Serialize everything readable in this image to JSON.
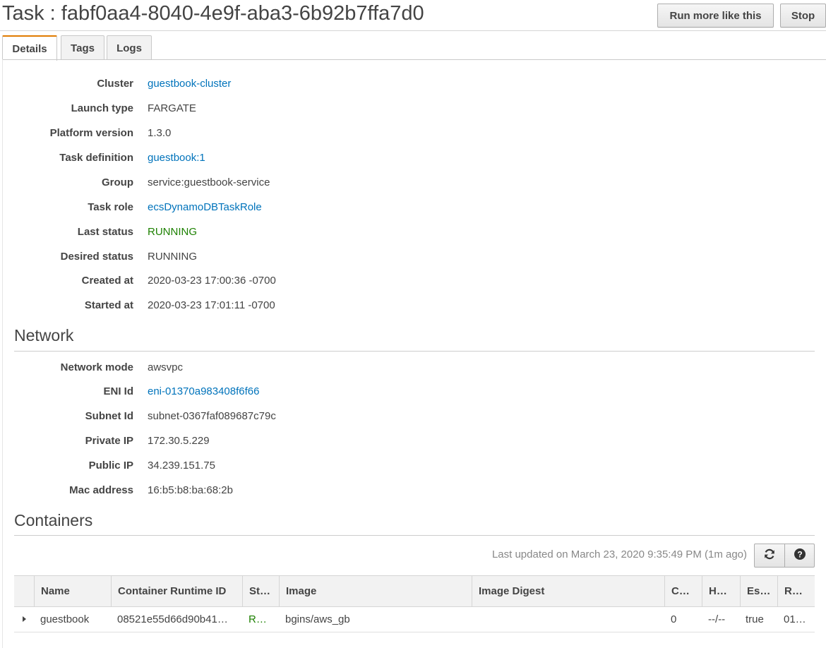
{
  "header": {
    "title": "Task : fabf0aa4-8040-4e9f-aba3-6b92b7ffa7d0",
    "run_more_label": "Run more like this",
    "stop_label": "Stop"
  },
  "tabs": [
    {
      "label": "Details",
      "active": true
    },
    {
      "label": "Tags",
      "active": false
    },
    {
      "label": "Logs",
      "active": false
    }
  ],
  "details": [
    {
      "label": "Cluster",
      "value": "guestbook-cluster"
    },
    {
      "label": "Launch type",
      "value": "FARGATE"
    },
    {
      "label": "Platform version",
      "value": "1.3.0"
    },
    {
      "label": "Task definition",
      "value": "guestbook:1"
    },
    {
      "label": "Group",
      "value": "service:guestbook-service"
    },
    {
      "label": "Task role",
      "value": "ecsDynamoDBTaskRole"
    },
    {
      "label": "Last status",
      "value": "RUNNING"
    },
    {
      "label": "Desired status",
      "value": "RUNNING"
    },
    {
      "label": "Created at",
      "value": "2020-03-23 17:00:36 -0700"
    },
    {
      "label": "Started at",
      "value": "2020-03-23 17:01:11 -0700"
    }
  ],
  "network": {
    "title": "Network",
    "rows": [
      {
        "label": "Network mode",
        "value": "awsvpc"
      },
      {
        "label": "ENI Id",
        "value": "eni-01370a983408f6f66"
      },
      {
        "label": "Subnet Id",
        "value": "subnet-0367faf089687c79c"
      },
      {
        "label": "Private IP",
        "value": "172.30.5.229"
      },
      {
        "label": "Public IP",
        "value": "34.239.151.75"
      },
      {
        "label": "Mac address",
        "value": "16:b5:b8:ba:68:2b"
      }
    ]
  },
  "containers": {
    "title": "Containers",
    "last_updated": "Last updated on March 23, 2020 9:35:49 PM (1m ago)",
    "columns": [
      "Name",
      "Container Runtime ID",
      "St…",
      "Image",
      "Image Digest",
      "C…",
      "H…",
      "Es…",
      "R…"
    ],
    "rows": [
      [
        "guestbook",
        "08521e55d66d90b41…",
        "R…",
        "bgins/aws_gb",
        "",
        "0",
        "--/--",
        "true",
        "01…"
      ]
    ]
  },
  "colors": {
    "link": "#0073bb",
    "running": "#1d8102",
    "active_tab_accent": "#e07b00"
  },
  "icons": {
    "refresh": "refresh-icon",
    "help": "help-icon",
    "expand": "caret-right-icon"
  }
}
